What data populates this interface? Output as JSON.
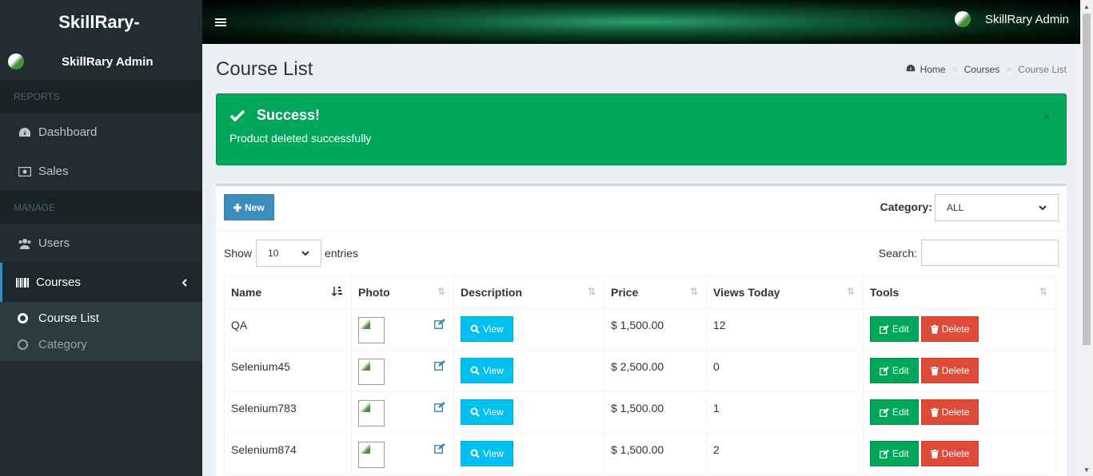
{
  "sidebar": {
    "logo": "SkillRary-",
    "user_name": "SkillRary Admin",
    "reports_header": "REPORTS",
    "manage_header": "MANAGE",
    "items": [
      {
        "label": "Dashboard",
        "icon": "dashboard-icon"
      },
      {
        "label": "Sales",
        "icon": "money-icon"
      },
      {
        "label": "Users",
        "icon": "users-icon"
      },
      {
        "label": "Courses",
        "icon": "barcode-icon"
      }
    ],
    "submenu": [
      {
        "label": "Course List"
      },
      {
        "label": "Category"
      }
    ]
  },
  "navbar": {
    "user_name": "SkillRary Admin"
  },
  "page": {
    "title": "Course List",
    "breadcrumb": [
      "Home",
      "Courses",
      "Course List"
    ]
  },
  "alert": {
    "title": "Success!",
    "message": "Product deleted successfully",
    "close": "×"
  },
  "box": {
    "new_label": "New",
    "category_label": "Category:",
    "category_value": "ALL",
    "show_label": "Show",
    "entries_value": "10",
    "entries_label": "entries",
    "search_label": "Search:"
  },
  "table": {
    "columns": [
      "Name",
      "Photo",
      "Description",
      "Price",
      "Views Today",
      "Tools"
    ],
    "view_label": "View",
    "edit_label": "Edit",
    "delete_label": "Delete",
    "rows": [
      {
        "name": "QA",
        "price": "$ 1,500.00",
        "views": "12"
      },
      {
        "name": "Selenium45",
        "price": "$ 2,500.00",
        "views": "0"
      },
      {
        "name": "Selenium783",
        "price": "$ 1,500.00",
        "views": "1"
      },
      {
        "name": "Selenium874",
        "price": "$ 1,500.00",
        "views": "2"
      }
    ]
  },
  "colors": {
    "sidebar_bg": "#222d32",
    "alert_success": "#00a65a",
    "btn_primary": "#3c8dbc",
    "btn_info": "#00c0ef",
    "btn_danger": "#dd4b39"
  }
}
